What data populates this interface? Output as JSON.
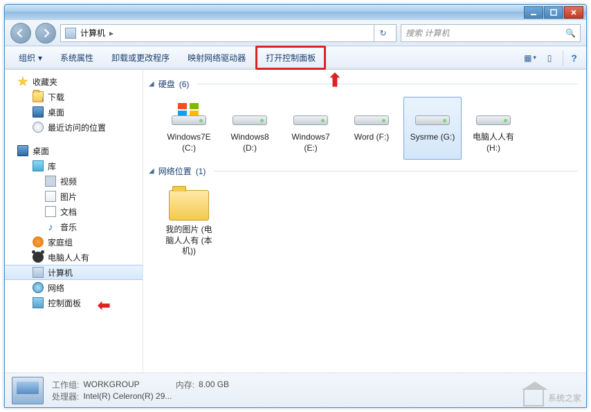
{
  "title_buttons": {
    "min": "minimize",
    "max": "maximize",
    "close": "close"
  },
  "nav": {
    "back": "back",
    "forward": "forward",
    "address_label": "计算机",
    "address_sep": "▸",
    "refresh": "↻"
  },
  "search": {
    "placeholder": "搜索 计算机",
    "icon": "🔍"
  },
  "toolbar": {
    "organize": "组织",
    "organize_chev": "▾",
    "props": "系统属性",
    "uninstall": "卸载或更改程序",
    "map_drive": "映射网络驱动器",
    "control_panel": "打开控制面板",
    "view_icon": "▦",
    "view_chev": "▾",
    "preview_icon": "▯",
    "help_icon": "?"
  },
  "sidebar": {
    "favorites": "收藏夹",
    "downloads": "下载",
    "desktop": "桌面",
    "recent": "最近访问的位置",
    "desktop2": "桌面",
    "library": "库",
    "videos": "视频",
    "pictures": "图片",
    "docs": "文档",
    "music": "音乐",
    "homegroup": "家庭组",
    "user": "电脑人人有",
    "computer": "计算机",
    "network": "网络",
    "cp": "控制面板"
  },
  "groups": {
    "drives": {
      "label": "硬盘",
      "count": "(6)"
    },
    "netloc": {
      "label": "网络位置",
      "count": "(1)"
    }
  },
  "drives": [
    {
      "name": "Windows7E (C:)",
      "type": "windows"
    },
    {
      "name": "Windows8 (D:)",
      "type": "hdd"
    },
    {
      "name": "Windows7 (E:)",
      "type": "hdd"
    },
    {
      "name": "Word (F:)",
      "type": "hdd"
    },
    {
      "name": "Sysrme (G:)",
      "type": "hdd",
      "selected": true
    },
    {
      "name": "电脑人人有 (H:)",
      "type": "hdd"
    }
  ],
  "netitems": [
    {
      "name": "我的图片 (电脑人人有 (本机))"
    }
  ],
  "status": {
    "workgroup_label": "工作组:",
    "workgroup": "WORKGROUP",
    "mem_label": "内存:",
    "mem": "8.00 GB",
    "cpu_label": "处理器:",
    "cpu": "Intel(R) Celeron(R) 29..."
  },
  "watermark": "系统之家"
}
